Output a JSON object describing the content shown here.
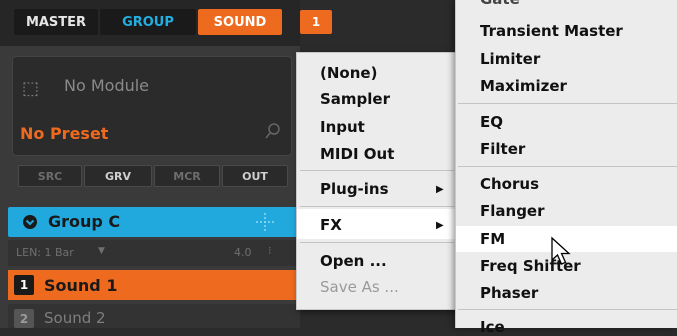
{
  "header": {
    "tabs": [
      {
        "label": "MASTER"
      },
      {
        "label": "GROUP"
      },
      {
        "label": "SOUND"
      }
    ],
    "page_badge": "1"
  },
  "module": {
    "name": "No Module",
    "preset": "No Preset",
    "buttons": [
      "SRC",
      "GRV",
      "MCR",
      "OUT"
    ]
  },
  "group": {
    "label": "Group C",
    "len_label": "LEN: 1 Bar",
    "len_value": "4.0"
  },
  "sounds": [
    {
      "number": "1",
      "label": "Sound 1"
    },
    {
      "number": "2",
      "label": "Sound 2"
    }
  ],
  "context_menu": {
    "items": [
      "(None)",
      "Sampler",
      "Input",
      "MIDI Out",
      "Plug-ins",
      "FX",
      "Open ...",
      "Save As ..."
    ]
  },
  "fx_submenu": {
    "items": [
      "Gate",
      "Transient Master",
      "Limiter",
      "Maximizer",
      "EQ",
      "Filter",
      "Chorus",
      "Flanger",
      "FM",
      "Freq Shifter",
      "Phaser",
      "Ice"
    ],
    "highlighted": "FM"
  },
  "colors": {
    "accent_orange": "#ee6a1f",
    "accent_blue": "#21a9de",
    "menu_bg": "#ececec"
  }
}
